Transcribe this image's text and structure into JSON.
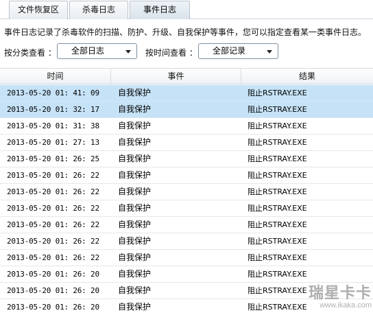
{
  "tabs": [
    {
      "label": "文件恢复区"
    },
    {
      "label": "杀毒日志"
    },
    {
      "label": "事件日志"
    }
  ],
  "active_tab": 2,
  "description": "事件日志记录了杀毒软件的扫描、防护、升级、自我保护等事件，您可以指定查看某一类事件日志。",
  "filters": {
    "category_label": "按分类查看 ：",
    "category_value": "全部日志",
    "time_label": "按时间查看 ：",
    "time_value": "全部记录"
  },
  "table": {
    "columns": [
      "时间",
      "事件",
      "结果"
    ],
    "rows": [
      {
        "time": "2013-05-20 01: 41: 09",
        "event": "自我保护",
        "result": "阻止RSTRAY.EXE",
        "selected": true
      },
      {
        "time": "2013-05-20 01: 32: 17",
        "event": "自我保护",
        "result": "阻止RSTRAY.EXE",
        "selected": true
      },
      {
        "time": "2013-05-20 01: 31: 38",
        "event": "自我保护",
        "result": "阻止RSTRAY.EXE",
        "selected": false
      },
      {
        "time": "2013-05-20 01: 27: 13",
        "event": "自我保护",
        "result": "阻止RSTRAY.EXE",
        "selected": false
      },
      {
        "time": "2013-05-20 01: 26: 25",
        "event": "自我保护",
        "result": "阻止RSTRAY.EXE",
        "selected": false
      },
      {
        "time": "2013-05-20 01: 26: 22",
        "event": "自我保护",
        "result": "阻止RSTRAY.EXE",
        "selected": false
      },
      {
        "time": "2013-05-20 01: 26: 22",
        "event": "自我保护",
        "result": "阻止RSTRAY.EXE",
        "selected": false
      },
      {
        "time": "2013-05-20 01: 26: 22",
        "event": "自我保护",
        "result": "阻止RSTRAY.EXE",
        "selected": false
      },
      {
        "time": "2013-05-20 01: 26: 22",
        "event": "自我保护",
        "result": "阻止RSTRAY.EXE",
        "selected": false
      },
      {
        "time": "2013-05-20 01: 26: 22",
        "event": "自我保护",
        "result": "阻止RSTRAY.EXE",
        "selected": false
      },
      {
        "time": "2013-05-20 01: 26: 22",
        "event": "自我保护",
        "result": "阻止RSTRAY.EXE",
        "selected": false
      },
      {
        "time": "2013-05-20 01: 26: 20",
        "event": "自我保护",
        "result": "阻止RSTRAY.EXE",
        "selected": false
      },
      {
        "time": "2013-05-20 01: 26: 20",
        "event": "自我保护",
        "result": "阻止RSTRAY.EXE",
        "selected": false
      },
      {
        "time": "2013-05-20 01: 26: 20",
        "event": "自我保护",
        "result": "阻止RSTRAY.EXE",
        "selected": false
      }
    ]
  },
  "watermark": {
    "logo": "瑞星卡卡",
    "url": "www.ikaka.com"
  }
}
